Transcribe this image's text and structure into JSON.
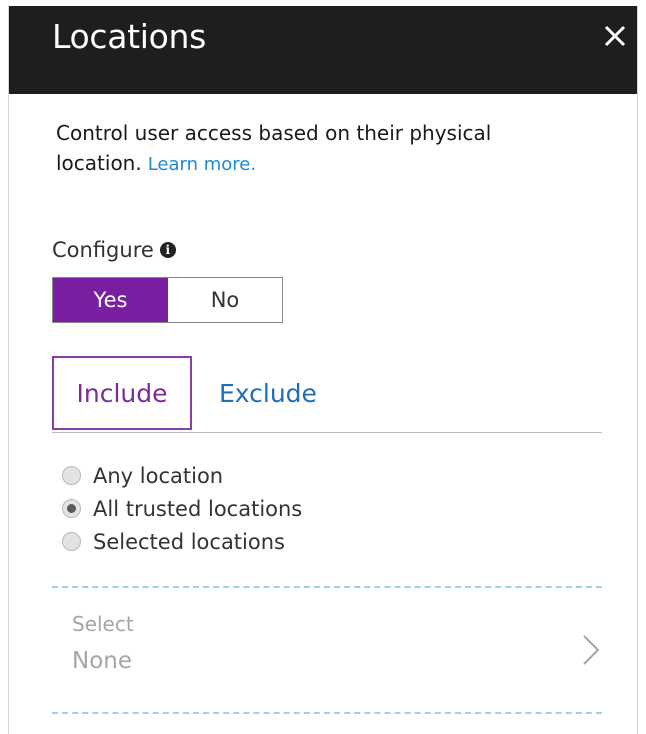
{
  "header": {
    "title": "Locations",
    "close_label": "×"
  },
  "description": {
    "text": "Control user access based on their physical location.",
    "link": "Learn more."
  },
  "configure": {
    "label": "Configure",
    "info_glyph": "i",
    "yes": "Yes",
    "no": "No",
    "selected": "Yes"
  },
  "tabs": [
    {
      "label": "Include",
      "active": true
    },
    {
      "label": "Exclude",
      "active": false
    }
  ],
  "location_options": [
    {
      "label": "Any location",
      "checked": false
    },
    {
      "label": "All trusted locations",
      "checked": true
    },
    {
      "label": "Selected locations",
      "checked": false
    }
  ],
  "select": {
    "label": "Select",
    "value": "None"
  },
  "colors": {
    "header_bg": "#1e1e1e",
    "accent_purple": "#7a1fa2",
    "link_blue": "#1c8ad6",
    "dash_blue": "#9fd0ec"
  }
}
